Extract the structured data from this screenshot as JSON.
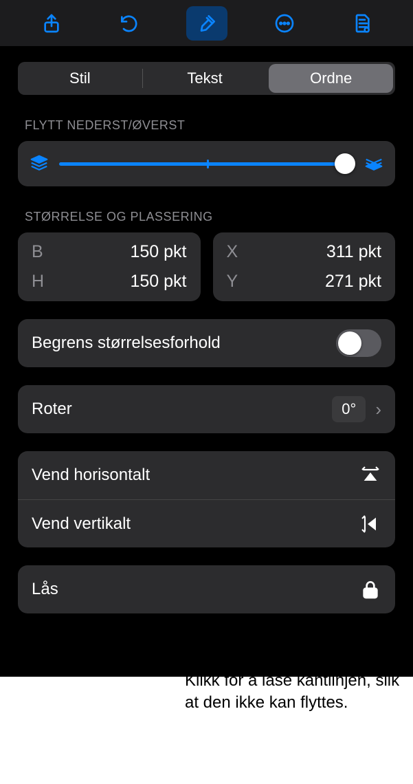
{
  "toolbar": {
    "share": "share-icon",
    "undo": "undo-icon",
    "format": "format-brush-icon",
    "more": "more-icon",
    "document": "document-icon"
  },
  "tabs": {
    "style": "Stil",
    "text": "Tekst",
    "arrange": "Ordne"
  },
  "layer": {
    "label": "FLYTT NEDERST/ØVERST"
  },
  "sizepos": {
    "label": "STØRRELSE OG PLASSERING",
    "b_key": "B",
    "b_val": "150 pkt",
    "h_key": "H",
    "h_val": "150 pkt",
    "x_key": "X",
    "x_val": "311 pkt",
    "y_key": "Y",
    "y_val": "271 pkt"
  },
  "constrain": {
    "label": "Begrens størrelsesforhold"
  },
  "rotate": {
    "label": "Roter",
    "value": "0°"
  },
  "fliph": {
    "label": "Vend horisontalt"
  },
  "flipv": {
    "label": "Vend vertikalt"
  },
  "lock": {
    "label": "Lås"
  },
  "callout": {
    "text": "Klikk for å låse kantlinjen, slik at den ikke kan flyttes."
  }
}
